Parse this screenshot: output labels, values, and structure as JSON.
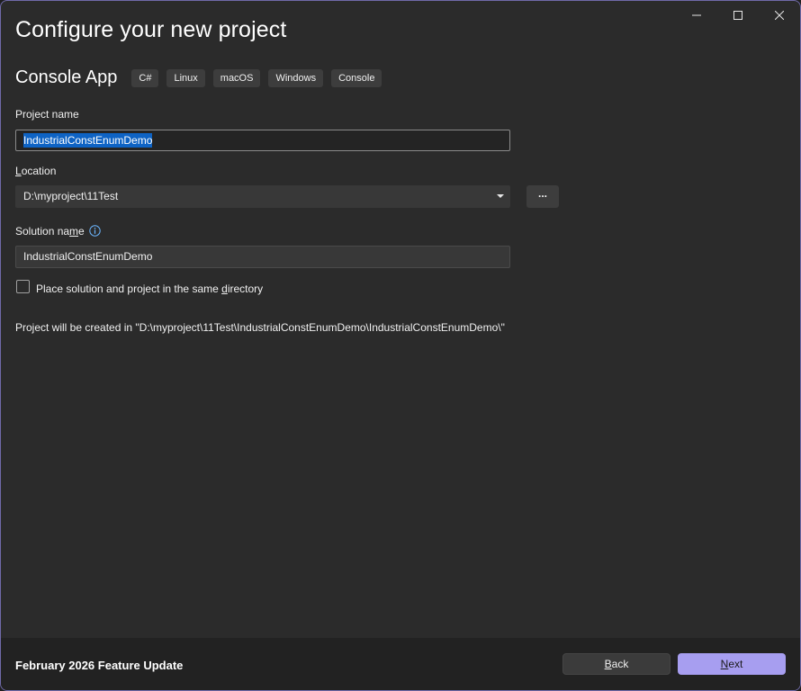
{
  "window": {
    "title": "Configure your new project",
    "controls": [
      "minimize-icon",
      "maximize-icon",
      "close-icon"
    ]
  },
  "template": {
    "name": "Console App",
    "tags": [
      "C#",
      "Linux",
      "macOS",
      "Windows",
      "Console"
    ]
  },
  "project_name": {
    "label": "Project name",
    "value": "IndustrialConstEnumDemo"
  },
  "location": {
    "label_prefix": "",
    "label_access_key": "L",
    "label_rest": "ocation",
    "value": "D:\\myproject\\11Test",
    "browse_label": "..."
  },
  "solution_name": {
    "label_prefix": "Solution na",
    "label_access_key": "m",
    "label_rest": "e",
    "info_icon": "info-icon",
    "value": "IndustrialConstEnumDemo"
  },
  "same_directory": {
    "label_prefix": "Place solution and project in the same ",
    "label_access_key": "d",
    "label_rest": "irectory",
    "checked": false
  },
  "path_info": "Project will be created in \"D:\\myproject\\11Test\\IndustrialConstEnumDemo\\IndustrialConstEnumDemo\\\"",
  "footer": {
    "version": "February 2026 Feature Update",
    "back_access_key": "B",
    "back_rest": "ack",
    "next_access_key": "N",
    "next_rest": "ext"
  },
  "colors": {
    "background": "#2b2b2b",
    "accent": "#a79ef0",
    "selection": "#0e63c4",
    "info_icon": "#6cb6ff"
  }
}
